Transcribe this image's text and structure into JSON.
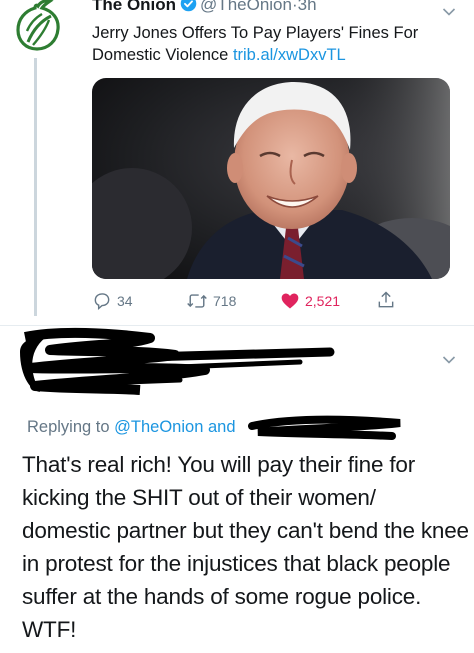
{
  "original_tweet": {
    "display_name": "The Onion",
    "handle": "@TheOnion",
    "separator": "·",
    "time": "3h",
    "text": "Jerry Jones Offers To Pay Players' Fines For Domestic Violence",
    "link": "trib.al/xwDxvTL",
    "actions": {
      "replies": "34",
      "retweets": "718",
      "likes": "2,521"
    },
    "colors": {
      "link": "#1b95e0",
      "like": "#e0245e",
      "muted": "#657786",
      "logo": "#2e7d32"
    }
  },
  "reply_tweet": {
    "replying_prefix": "Replying to",
    "replying_mention": "@TheOnion",
    "replying_and": "and",
    "text": "That's real rich! You will pay their fine for kicking the SHIT out of their women/ domestic partner but they can't bend the knee in protest for the injustices that black people suffer at the hands of some rogue police. WTF!"
  }
}
